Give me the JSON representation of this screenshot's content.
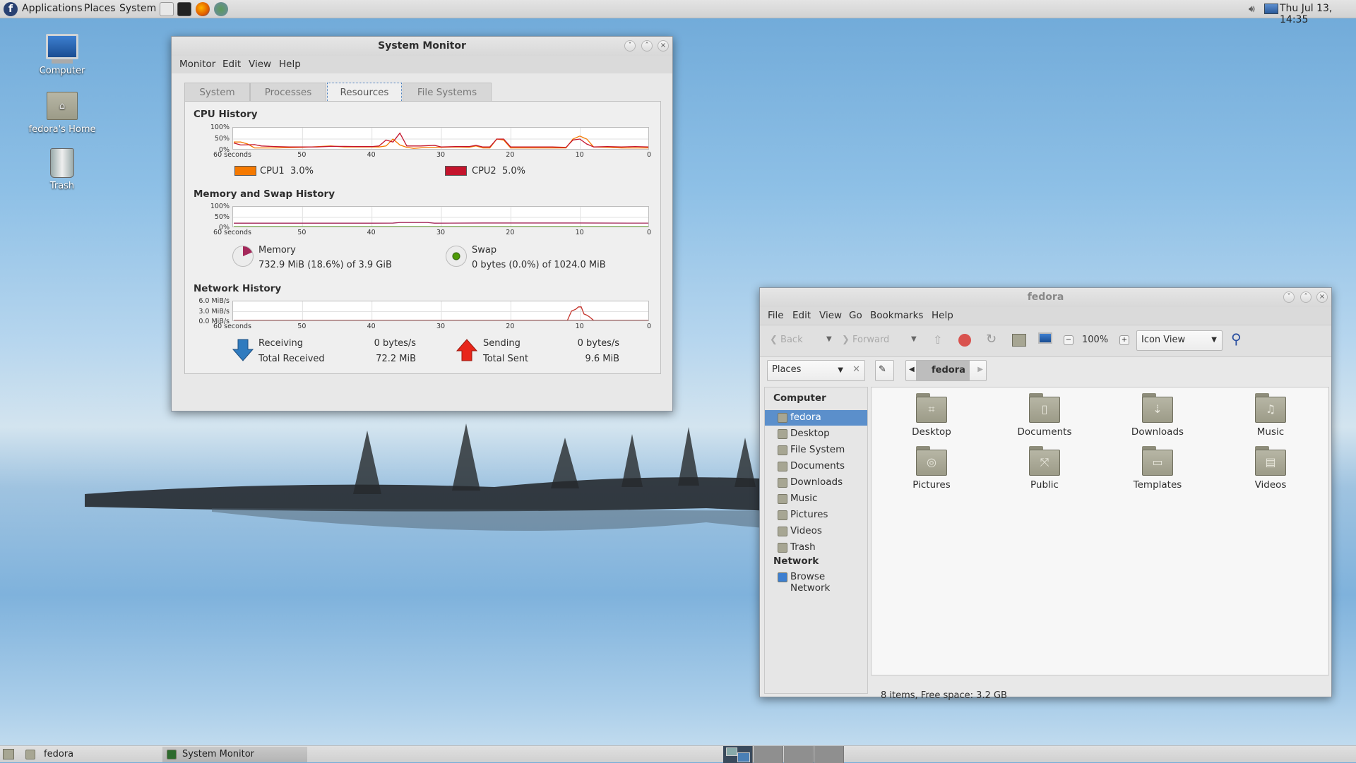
{
  "top_panel": {
    "menus": [
      "Applications",
      "Places",
      "System"
    ],
    "launchers": [
      "file-manager-icon",
      "terminal-icon",
      "firefox-icon",
      "mail-icon"
    ],
    "clock": "Thu Jul 13, 14:35"
  },
  "desktop": {
    "icons": [
      {
        "label": "Computer",
        "icon": "computer-icon"
      },
      {
        "label": "fedora's Home",
        "icon": "home-folder-icon"
      },
      {
        "label": "Trash",
        "icon": "trash-icon"
      }
    ]
  },
  "sysmon": {
    "title": "System Monitor",
    "menu": [
      "Monitor",
      "Edit",
      "View",
      "Help"
    ],
    "tabs": [
      "System",
      "Processes",
      "Resources",
      "File Systems"
    ],
    "active_tab": "Resources",
    "cpu": {
      "title": "CPU History",
      "cpu1_label": "CPU1",
      "cpu1_value": "3.0%",
      "cpu2_label": "CPU2",
      "cpu2_value": "5.0%",
      "cpu1_color": "#f57900",
      "cpu2_color": "#c4142c"
    },
    "mem": {
      "title": "Memory and Swap History",
      "memory_label": "Memory",
      "memory_value": "732.9 MiB (18.6%) of 3.9 GiB",
      "swap_label": "Swap",
      "swap_value": "0 bytes (0.0%) of 1024.0 MiB",
      "memory_color": "#a4285a",
      "swap_color": "#4e9a06"
    },
    "net": {
      "title": "Network History",
      "receiving_label": "Receiving",
      "receiving_value": "0 bytes/s",
      "total_received_label": "Total Received",
      "total_received_value": "72.2 MiB",
      "sending_label": "Sending",
      "sending_value": "0 bytes/s",
      "total_sent_label": "Total Sent",
      "total_sent_value": "9.6 MiB"
    }
  },
  "chart_data": [
    {
      "type": "line",
      "title": "CPU History",
      "x_ticks": [
        "60 seconds",
        "50",
        "40",
        "30",
        "20",
        "10",
        "0"
      ],
      "y_ticks": [
        "100%",
        "50%",
        "0%"
      ],
      "xlim": [
        60,
        0
      ],
      "ylim": [
        0,
        100
      ],
      "grid": true,
      "series": [
        {
          "name": "CPU1",
          "color": "#f57900",
          "x": [
            60,
            59,
            58,
            57,
            54,
            50,
            46,
            44,
            40,
            39,
            38,
            37,
            36,
            35,
            34,
            32,
            30,
            28,
            26,
            25,
            24,
            23,
            22,
            21,
            20,
            14,
            12,
            11,
            10,
            9,
            8,
            6,
            4,
            2,
            0
          ],
          "y": [
            35,
            35,
            25,
            5,
            5,
            8,
            15,
            10,
            10,
            10,
            15,
            50,
            20,
            8,
            3,
            8,
            8,
            10,
            8,
            15,
            5,
            5,
            50,
            45,
            5,
            5,
            5,
            50,
            65,
            50,
            10,
            8,
            5,
            5,
            5
          ]
        },
        {
          "name": "CPU2",
          "color": "#c4142c",
          "x": [
            60,
            59,
            57,
            56,
            54,
            52,
            50,
            48,
            46,
            44,
            42,
            40,
            39,
            38,
            37,
            36,
            35,
            33,
            31,
            30,
            28,
            26,
            25,
            24,
            23,
            22,
            21,
            20,
            18,
            14,
            12,
            11,
            10,
            9,
            8,
            6,
            4,
            2,
            0
          ],
          "y": [
            30,
            20,
            22,
            15,
            12,
            10,
            10,
            10,
            13,
            13,
            12,
            12,
            15,
            45,
            35,
            80,
            15,
            15,
            18,
            10,
            12,
            12,
            18,
            10,
            10,
            50,
            50,
            10,
            10,
            10,
            8,
            45,
            50,
            25,
            10,
            12,
            10,
            12,
            10
          ]
        }
      ]
    },
    {
      "type": "line",
      "title": "Memory and Swap History",
      "x_ticks": [
        "60 seconds",
        "50",
        "40",
        "30",
        "20",
        "10",
        "0"
      ],
      "y_ticks": [
        "100%",
        "50%",
        "0%"
      ],
      "xlim": [
        60,
        0
      ],
      "ylim": [
        0,
        100
      ],
      "grid": true,
      "series": [
        {
          "name": "Memory",
          "color": "#a4285a",
          "x": [
            60,
            40,
            37,
            36,
            32,
            31,
            24,
            10,
            0
          ],
          "y": [
            18.6,
            18.6,
            19,
            22,
            22,
            18.5,
            19.5,
            19.5,
            18.6
          ]
        },
        {
          "name": "Swap",
          "color": "#4e9a06",
          "x": [
            60,
            0
          ],
          "y": [
            0,
            0
          ]
        }
      ]
    },
    {
      "type": "line",
      "title": "Network History",
      "x_ticks": [
        "60 seconds",
        "50",
        "40",
        "30",
        "20",
        "10",
        "0"
      ],
      "y_ticks": [
        "6.0 MiB/s",
        "3.0 MiB/s",
        "0.0 MiB/s"
      ],
      "xlim": [
        60,
        0
      ],
      "ylim": [
        0,
        6
      ],
      "grid": true,
      "series": [
        {
          "name": "Receiving",
          "color": "#c4342c",
          "x": [
            60,
            11.8,
            11.2,
            10.6,
            10.2,
            9.8,
            9.4,
            9,
            8.6,
            8,
            0
          ],
          "y": [
            0,
            0,
            3.2,
            3.8,
            4.6,
            4.6,
            2.2,
            1.8,
            1.2,
            0,
            0
          ]
        },
        {
          "name": "Sending",
          "color": "#8f2626",
          "x": [
            60,
            0
          ],
          "y": [
            0,
            0
          ]
        }
      ]
    }
  ],
  "fm": {
    "title": "fedora",
    "menu": [
      "File",
      "Edit",
      "View",
      "Go",
      "Bookmarks",
      "Help"
    ],
    "toolbar": {
      "back": "Back",
      "forward": "Forward",
      "zoom": "100%",
      "view_mode": "Icon View"
    },
    "places_combo": "Places",
    "path": "fedora",
    "sidebar": {
      "computer_heading": "Computer",
      "network_heading": "Network",
      "items": [
        "fedora",
        "Desktop",
        "File System",
        "Documents",
        "Downloads",
        "Music",
        "Pictures",
        "Videos",
        "Trash"
      ],
      "network_items": [
        "Browse Network"
      ],
      "selected": "fedora"
    },
    "files": [
      {
        "name": "Desktop",
        "glyph": "⌗"
      },
      {
        "name": "Documents",
        "glyph": "▯"
      },
      {
        "name": "Downloads",
        "glyph": "⇣"
      },
      {
        "name": "Music",
        "glyph": "♫"
      },
      {
        "name": "Pictures",
        "glyph": "◎"
      },
      {
        "name": "Public",
        "glyph": "⤧"
      },
      {
        "name": "Templates",
        "glyph": "▭"
      },
      {
        "name": "Videos",
        "glyph": "▤"
      }
    ],
    "status": "8 items, Free space: 3.2 GB"
  },
  "bottom_panel": {
    "tasks": [
      "fedora",
      "System Monitor"
    ],
    "workspaces": 4
  }
}
